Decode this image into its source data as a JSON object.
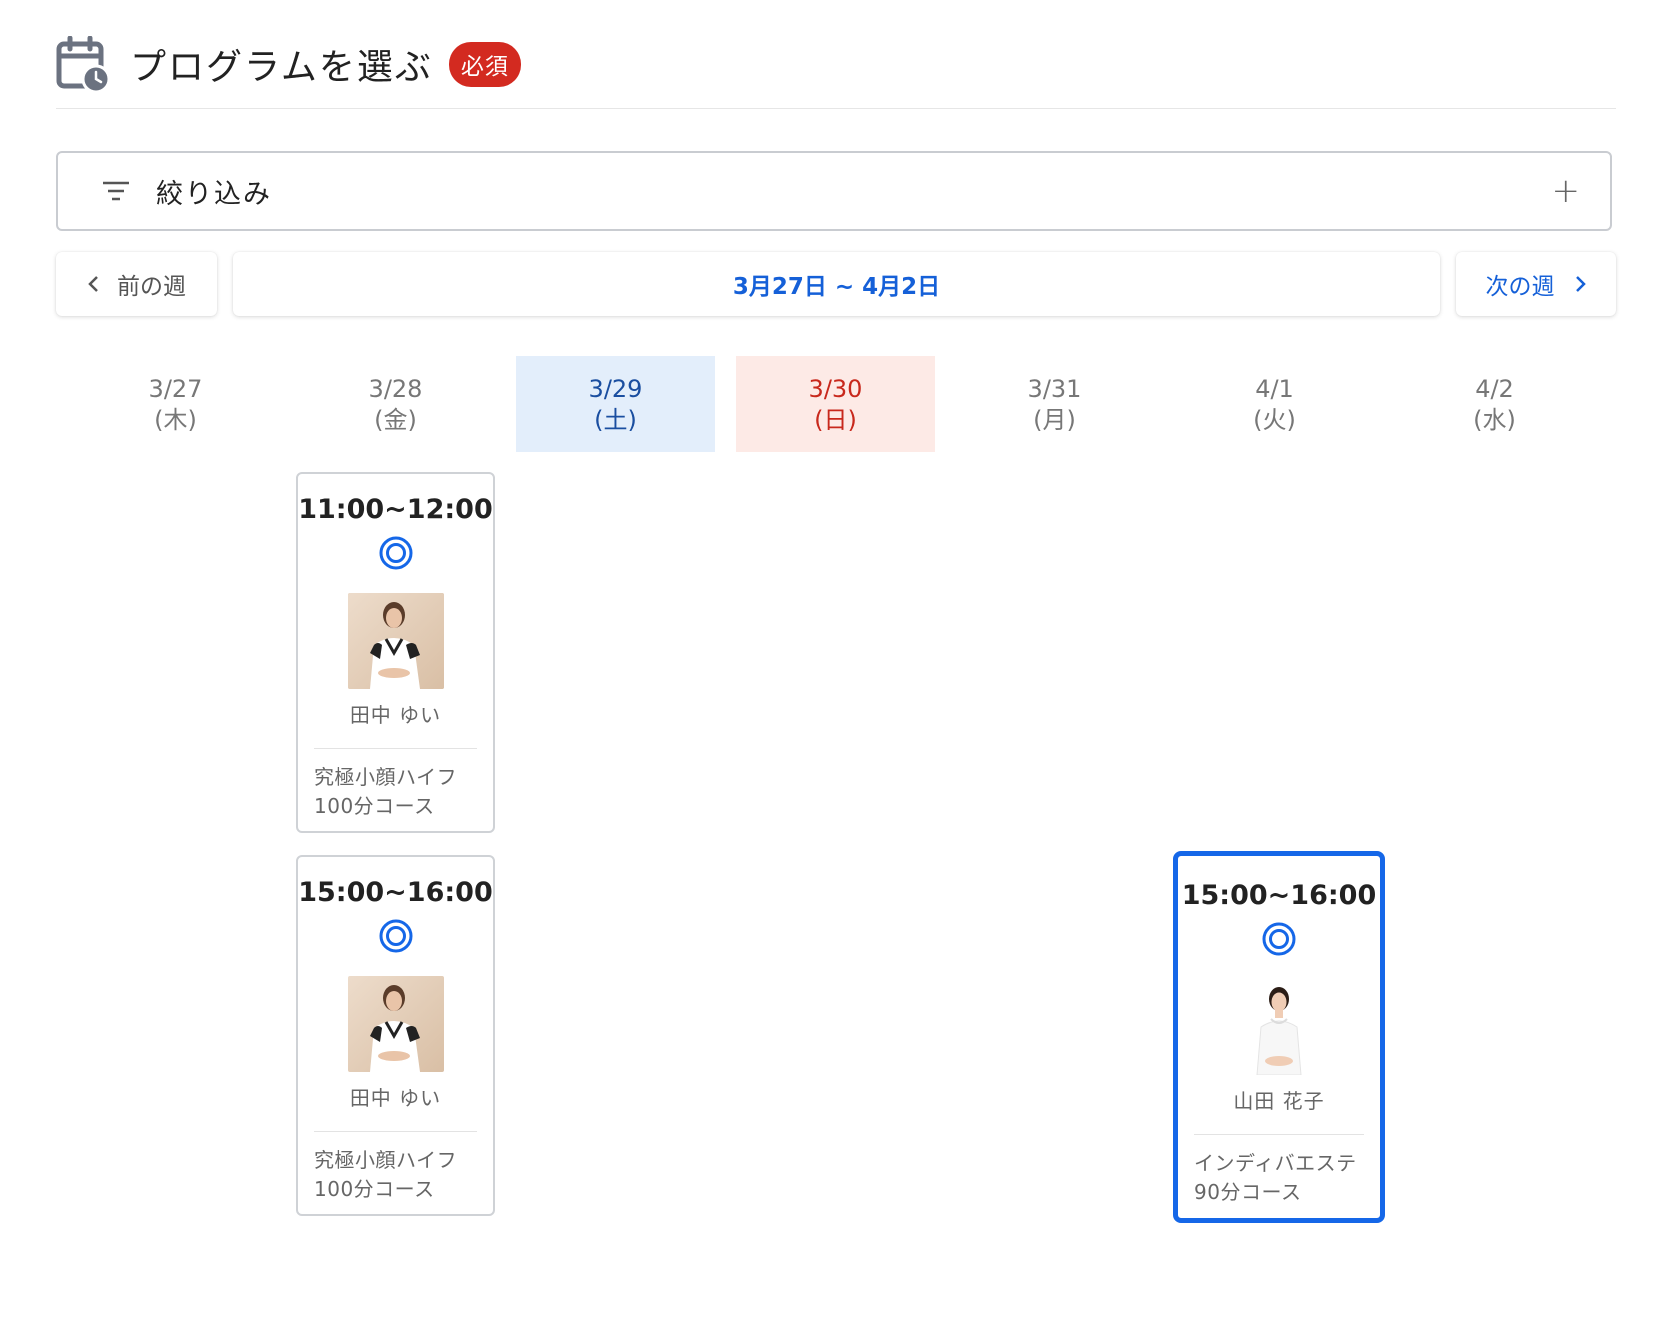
{
  "header": {
    "title": "プログラムを選ぶ",
    "required_badge": "必須",
    "icon": "calendar-clock-icon"
  },
  "filter": {
    "label": "絞り込み",
    "icon": "filter-icon",
    "expand_icon": "plus-icon"
  },
  "week_nav": {
    "prev_label": "前の週",
    "range_label": "3月27日 ~ 4月2日",
    "next_label": "次の週"
  },
  "days": [
    {
      "date": "3/27",
      "weekday": "(木)",
      "type": "weekday"
    },
    {
      "date": "3/28",
      "weekday": "(金)",
      "type": "weekday"
    },
    {
      "date": "3/29",
      "weekday": "(土)",
      "type": "saturday"
    },
    {
      "date": "3/30",
      "weekday": "(日)",
      "type": "sunday"
    },
    {
      "date": "3/31",
      "weekday": "(月)",
      "type": "weekday"
    },
    {
      "date": "4/1",
      "weekday": "(火)",
      "type": "weekday"
    },
    {
      "date": "4/2",
      "weekday": "(水)",
      "type": "weekday"
    }
  ],
  "slots": [
    {
      "time": "11:00~12:00",
      "availability": "available-double-circle-icon",
      "staff": "田中 ゆい",
      "course_line1": "究極小顔ハイフ",
      "course_line2": "100分コース",
      "selected": false
    },
    {
      "time": "15:00~16:00",
      "availability": "available-double-circle-icon",
      "staff": "田中 ゆい",
      "course_line1": "究極小顔ハイフ",
      "course_line2": "100分コース",
      "selected": false
    },
    {
      "time": "15:00~16:00",
      "availability": "available-double-circle-icon",
      "staff": "山田 花子",
      "course_line1": "インディバエステ",
      "course_line2": "90分コース",
      "selected": true
    }
  ],
  "colors": {
    "accent": "#1567e8",
    "required": "#d32a20",
    "saturday_bg": "#e3eefb",
    "sunday_bg": "#fdeae6"
  }
}
